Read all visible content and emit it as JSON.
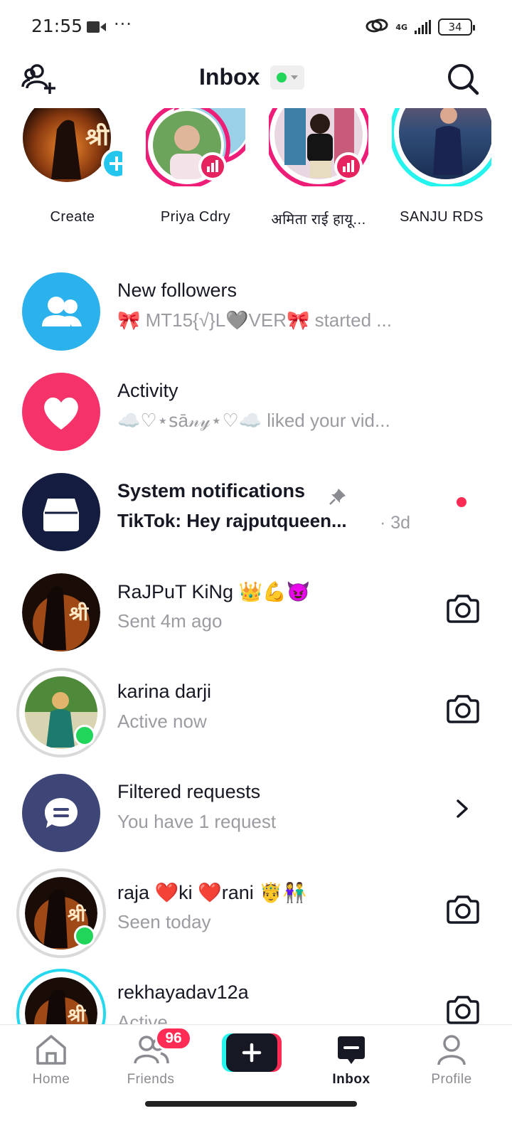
{
  "status_bar": {
    "time": "21:55",
    "dots": "···",
    "network": "4G",
    "battery": "34"
  },
  "header": {
    "title": "Inbox",
    "online_status_color": "#20d55a"
  },
  "stories": [
    {
      "name": "Create"
    },
    {
      "name": "Priya Cdry"
    },
    {
      "name": "अमिता राई हायू..."
    },
    {
      "name": "SANJU RDS"
    }
  ],
  "rows": [
    {
      "title": "New followers",
      "subtitle": "🎀 MT15{√}L🩶VER🎀 started ..."
    },
    {
      "title": "Activity",
      "subtitle": "☁️♡⋆ꜱā𝓃𝓎⋆♡☁️ liked your vid..."
    },
    {
      "title": "System notifications",
      "subtitle": "TikTok: Hey rajputqueen...",
      "time": "· 3d"
    },
    {
      "title": "RaJPuT KiNg 👑💪😈",
      "subtitle": "Sent 4m ago"
    },
    {
      "title": "karina darji",
      "subtitle": "Active now"
    },
    {
      "title": "Filtered requests",
      "subtitle": "You have 1 request"
    },
    {
      "title": "raja ❤️ki ❤️rani 🤴👫",
      "subtitle": "Seen today"
    },
    {
      "title": "rekhayadav12a",
      "subtitle": "Active"
    }
  ],
  "nav": {
    "home": "Home",
    "friends": "Friends",
    "friends_badge": "96",
    "inbox": "Inbox",
    "profile": "Profile"
  },
  "colors": {
    "followers": "#2bb1ec",
    "activity": "#f5326a",
    "system": "#141c3f",
    "filtered": "#3e4677",
    "accent": "#fe2c55",
    "teal": "#25f4ee"
  }
}
